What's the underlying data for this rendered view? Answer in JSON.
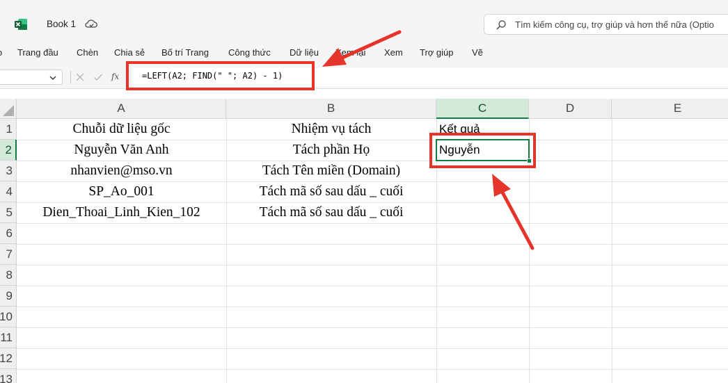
{
  "window": {
    "title": "Book 1",
    "app_icon": "excel-app-icon",
    "cloud_icon": "cloud-sync-icon"
  },
  "search": {
    "placeholder": "Tìm kiếm công cụ, trợ giúp và hơn thế nữa (Optio",
    "icon": "search-icon"
  },
  "ribbon": {
    "tabs": [
      "o",
      "Trang đầu",
      "Chèn",
      "Chia sẻ",
      "Bố trí Trang",
      "Công thức",
      "Dữ liệu",
      "Xem lại",
      "Xem",
      "Trợ giúp",
      "Vẽ"
    ]
  },
  "formula_bar": {
    "name_box": "",
    "fx": "fx",
    "formula": "=LEFT(A2; FIND(\" \"; A2) - 1)"
  },
  "sheet": {
    "columns": [
      "A",
      "B",
      "C",
      "D",
      "E"
    ],
    "selected_column": "C",
    "rows": [
      "1",
      "2",
      "3",
      "4",
      "5",
      "6",
      "7",
      "8",
      "9",
      "10",
      "11",
      "12",
      "13"
    ],
    "selected_row": "2",
    "active_cell": "C2",
    "cells": {
      "A1": "Chuỗi dữ liệu gốc",
      "B1": "Nhiệm vụ tách",
      "C1": "Kết quả",
      "A2": "Nguyễn Văn Anh",
      "B2": "Tách phần Họ",
      "C2": "Nguyễn",
      "A3": "nhanvien@mso.vn",
      "B3": "Tách Tên miền (Domain)",
      "A4": "SP_Ao_001",
      "B4": "Tách mã số sau dấu _ cuối",
      "A5": "Dien_Thoai_Linh_Kien_102",
      "B5": "Tách mã số sau dấu _ cuối"
    }
  },
  "annotation_color": "#e5352b",
  "selection_color": "#107c41"
}
